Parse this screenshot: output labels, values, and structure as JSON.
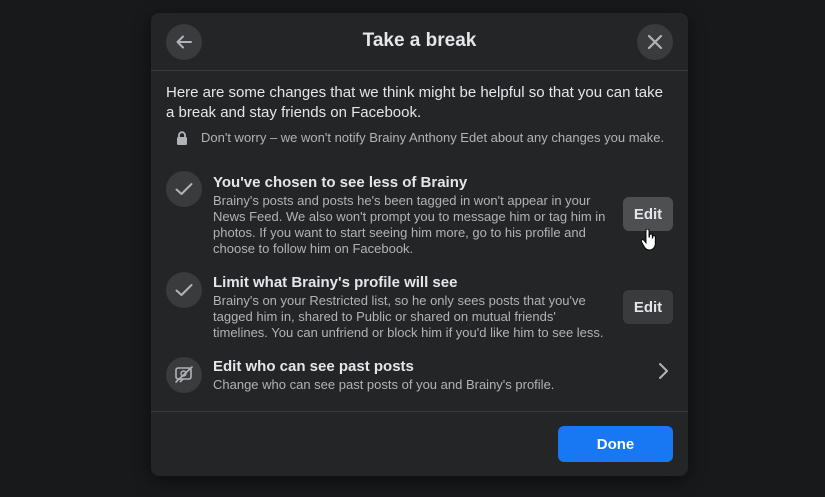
{
  "modal": {
    "title": "Take a break",
    "back_icon": "arrow-left-icon",
    "close_icon": "close-icon"
  },
  "intro": "Here are some changes that we think might be helpful so that you can take a break and stay friends on Facebook.",
  "notice": {
    "icon": "lock-icon",
    "text": "Don't worry – we won't notify Brainy Anthony Edet about any changes you make."
  },
  "options": [
    {
      "icon": "check-icon",
      "title": "You've chosen to see less of Brainy",
      "description": "Brainy's posts and posts he's been tagged in won't appear in your News Feed. We also won't prompt you to message him or tag him in photos. If you want to start seeing him more, go to his profile and choose to follow him on Facebook.",
      "action_label": "Edit"
    },
    {
      "icon": "check-icon",
      "title": "Limit what Brainy's profile will see",
      "description": "Brainy's on your Restricted list, so he only sees posts that you've tagged him in, shared to Public or shared on mutual friends' timelines. You can unfriend or block him if you'd like him to see less.",
      "action_label": "Edit"
    },
    {
      "icon": "hidden-posts-icon",
      "title": "Edit who can see past posts",
      "description": "Change who can see past posts of you and Brainy's profile.",
      "action_icon": "chevron-right-icon"
    }
  ],
  "footer": {
    "done_label": "Done"
  },
  "colors": {
    "background": "#18191a",
    "surface": "#242526",
    "control": "#3a3b3c",
    "primary_text": "#e4e6eb",
    "secondary_text": "#b0b3b8",
    "accent": "#1877f2"
  }
}
